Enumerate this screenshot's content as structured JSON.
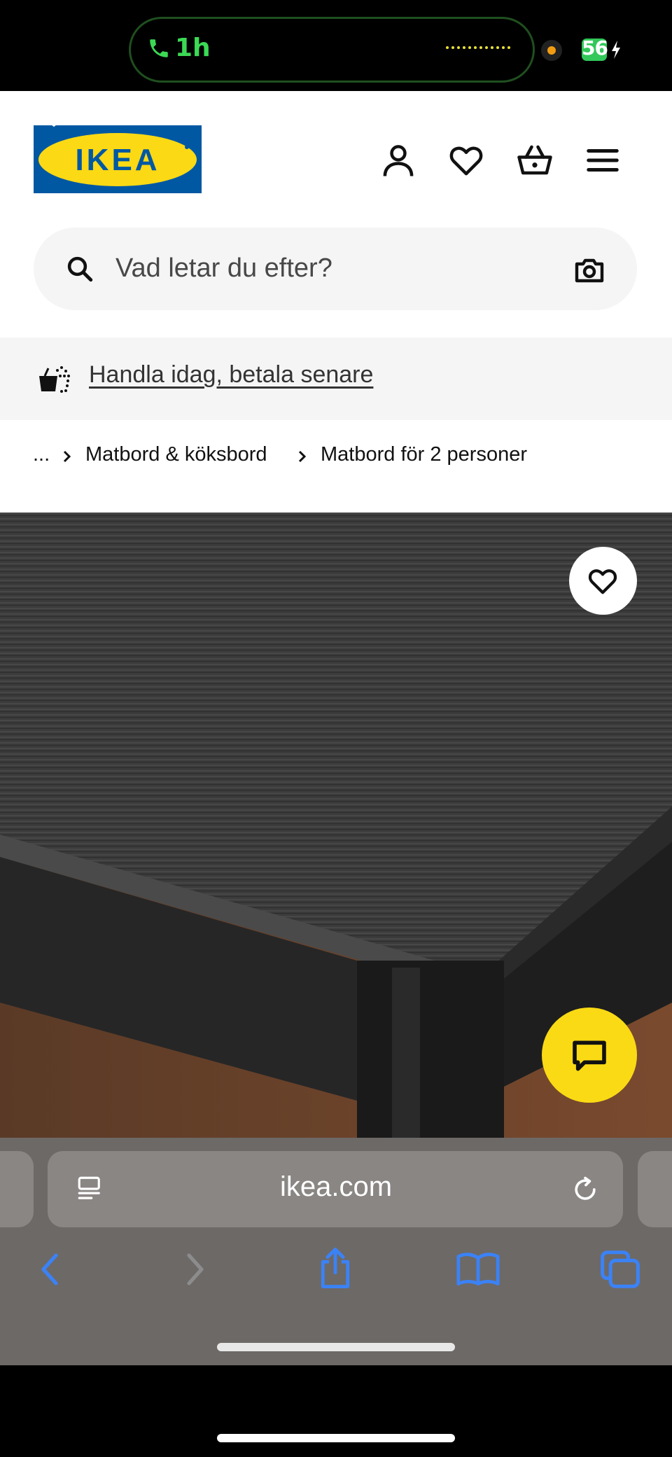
{
  "status_bar": {
    "call_duration": "1h",
    "battery_level": "56"
  },
  "header": {
    "logo_text": "IKEA"
  },
  "search": {
    "placeholder": "Vad letar du efter?"
  },
  "promo": {
    "label": "Handla idag, betala senare"
  },
  "breadcrumb": {
    "ellipsis": "...",
    "items": [
      "Matbord & köksbord",
      "Matbord för 2 personer"
    ]
  },
  "browser": {
    "url": "ikea.com"
  },
  "colors": {
    "ikea_blue": "#0058a3",
    "ikea_yellow": "#fbd914",
    "safari_blue": "#3b82f6"
  }
}
